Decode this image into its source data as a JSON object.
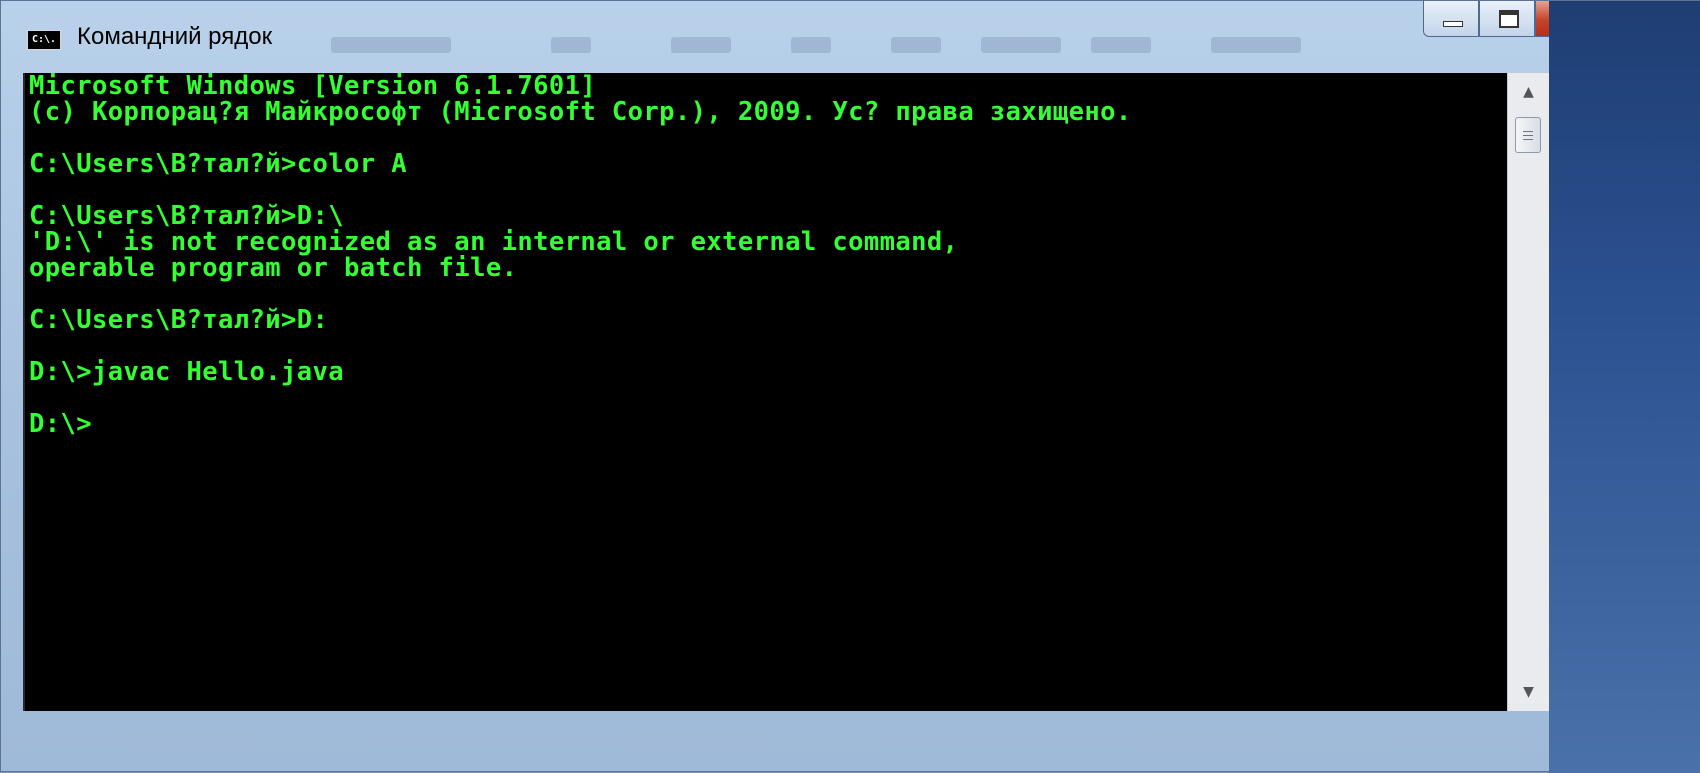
{
  "window": {
    "title": "Командний рядок",
    "icon_label": "C:\\."
  },
  "console": {
    "lines": [
      "Microsoft Windows [Version 6.1.7601]",
      "(c) Корпорац?я Майкрософт (Microsoft Corp.), 2009. Ус? права захищено.",
      "",
      "C:\\Users\\В?тал?й>color A",
      "",
      "C:\\Users\\В?тал?й>D:\\",
      "'D:\\' is not recognized as an internal or external command,",
      "operable program or batch file.",
      "",
      "C:\\Users\\В?тал?й>D:",
      "",
      "D:\\>javac Hello.java",
      "",
      "D:\\>"
    ],
    "text_color": "#33ff33",
    "background": "#000000"
  },
  "caption_buttons": {
    "minimize": "minimize",
    "maximize": "maximize",
    "close": "close"
  },
  "icons": {
    "window_icon": "cmd-icon",
    "minimize": "minimize-icon",
    "maximize": "maximize-icon",
    "close": "close-icon",
    "scroll_up": "arrow-up-icon",
    "scroll_down": "arrow-down-icon"
  }
}
